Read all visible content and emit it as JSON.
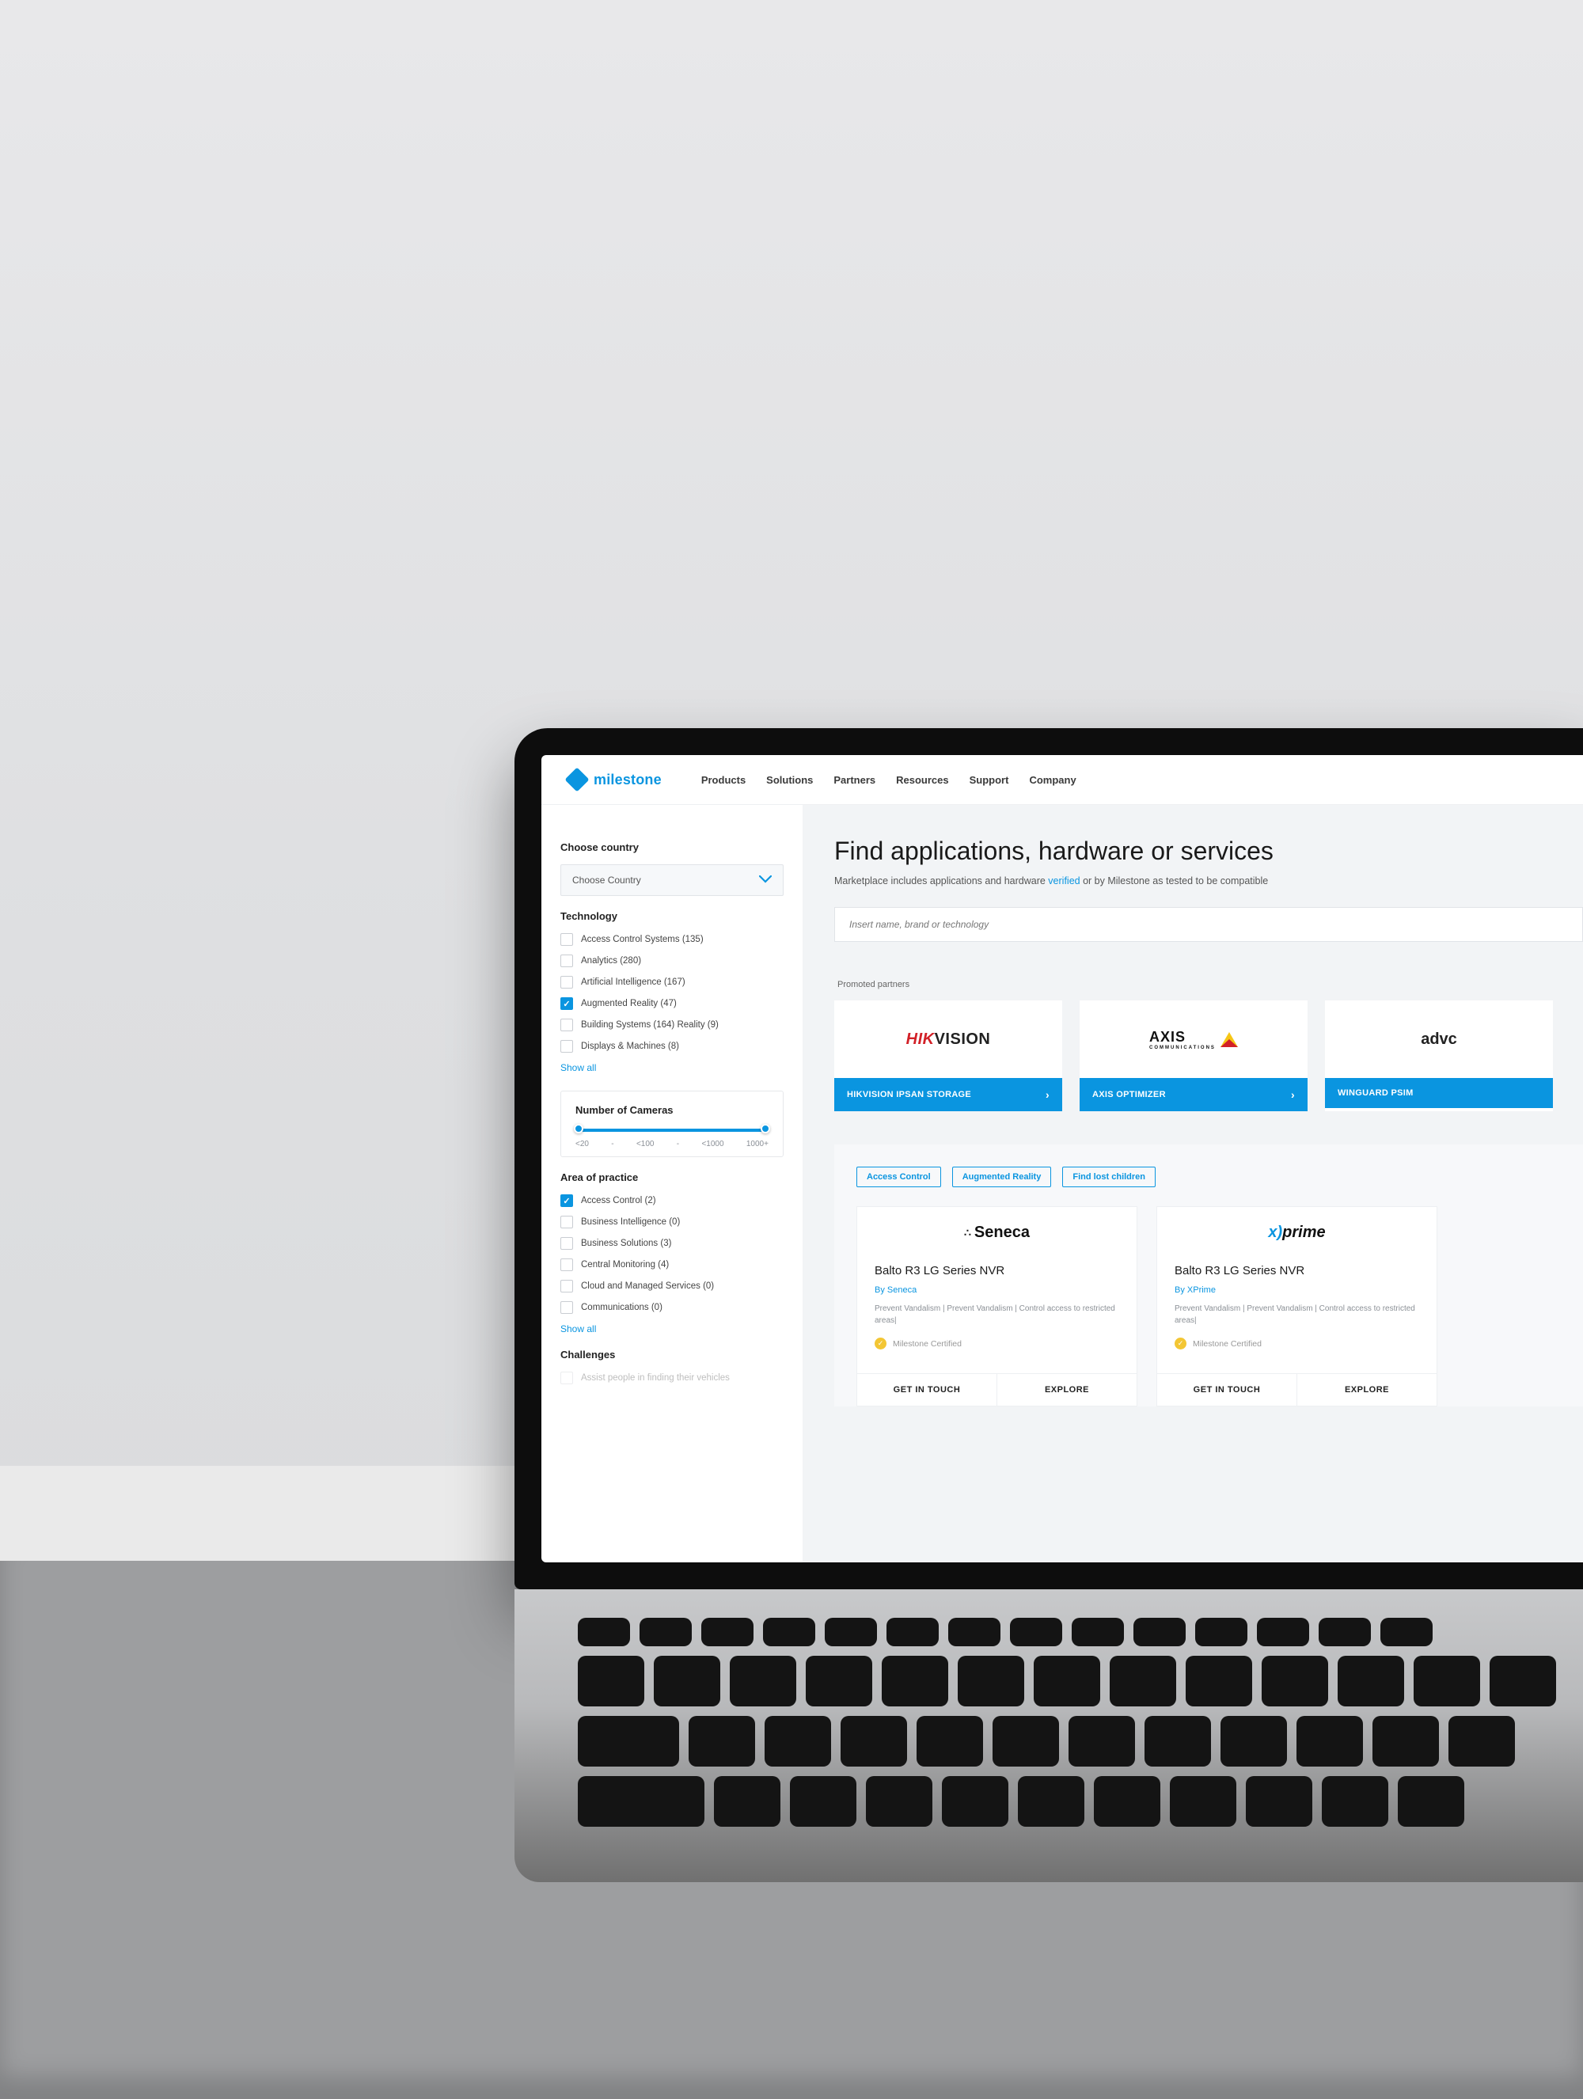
{
  "brand": {
    "name": "milestone"
  },
  "nav": [
    "Products",
    "Solutions",
    "Partners",
    "Resources",
    "Support",
    "Company"
  ],
  "sidebar": {
    "country_label": "Choose country",
    "country_placeholder": "Choose Country",
    "tech_label": "Technology",
    "tech": [
      {
        "label": "Access Control Systems (135)",
        "checked": false
      },
      {
        "label": "Analytics (280)",
        "checked": false
      },
      {
        "label": "Artificial Intelligence (167)",
        "checked": false
      },
      {
        "label": "Augmented Reality (47)",
        "checked": true
      },
      {
        "label": "Building Systems (164) Reality (9)",
        "checked": false
      },
      {
        "label": "Displays & Machines (8)",
        "checked": false
      }
    ],
    "show_all": "Show all",
    "slider_title": "Number of Cameras",
    "slider_ticks": [
      "<20",
      "-",
      "<100",
      "-",
      "<1000",
      "1000+"
    ],
    "area_label": "Area of practice",
    "area": [
      {
        "label": "Access Control (2)",
        "checked": true
      },
      {
        "label": "Business Intelligence (0)",
        "checked": false
      },
      {
        "label": "Business Solutions (3)",
        "checked": false
      },
      {
        "label": "Central Monitoring (4)",
        "checked": false
      },
      {
        "label": "Cloud and Managed Services (0)",
        "checked": false
      },
      {
        "label": "Communications (0)",
        "checked": false
      }
    ],
    "challenges_label": "Challenges",
    "challenges_first": "Assist people in finding their vehicles"
  },
  "main": {
    "title": "Find applications, hardware or  services",
    "subtitle_a": "Marketplace includes applications and hardware ",
    "subtitle_link": "verified",
    "subtitle_b": " or    by Milestone as tested to be compatible",
    "search_placeholder": "Insert name, brand or technology",
    "promoted_label": "Promoted partners",
    "partners": [
      {
        "logo": "HIKVISION",
        "band": "HIKVISION IPSAN STORAGE"
      },
      {
        "logo": "AXIS",
        "sub": "COMMUNICATIONS",
        "band": "AXIS OPTIMIZER"
      },
      {
        "logo": "advc",
        "band": "WINGUARD PSIM"
      }
    ],
    "tags": [
      "Access Control",
      "Augmented Reality",
      "Find lost children"
    ],
    "products": [
      {
        "brand": "Seneca",
        "title": "Balto R3 LG Series NVR",
        "by": "By Seneca",
        "desc": "Prevent Vandalism | Prevent Vandalism | Control access to restricted areas|",
        "cert": "Milestone Certified",
        "a1": "GET IN TOUCH",
        "a2": "EXPLORE"
      },
      {
        "brand": "x)prime",
        "title": "Balto R3 LG Series NVR",
        "by": "By XPrime",
        "desc": "Prevent Vandalism | Prevent Vandalism | Control access to restricted areas|",
        "cert": "Milestone Certified",
        "a1": "GET IN TOUCH",
        "a2": "EXPLORE"
      }
    ]
  }
}
